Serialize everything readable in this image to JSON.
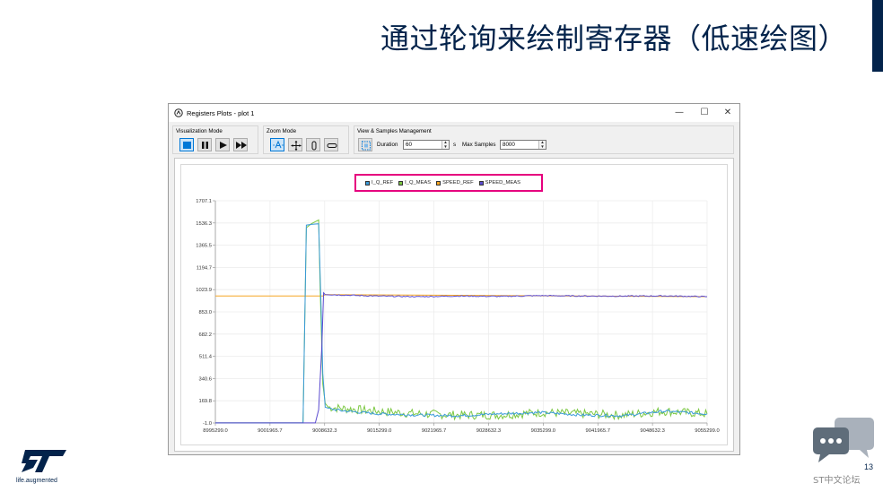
{
  "slide": {
    "title": "通过轮询来绘制寄存器（低速绘图）",
    "page_number": "13",
    "brand_tagline": "life.augmented",
    "forum_label": "ST中文论坛",
    "colors": {
      "navy": "#03234b",
      "highlight": "#e6007e"
    }
  },
  "window": {
    "title": "Registers Plots - plot 1",
    "controls": {
      "minimize": "—",
      "maximize": "☐",
      "close": "✕"
    }
  },
  "toolbar": {
    "visualization": {
      "label": "Visualization Mode",
      "buttons": [
        "stop-icon",
        "pause-icon",
        "play-icon",
        "fast-forward-icon"
      ]
    },
    "zoom": {
      "label": "Zoom Mode",
      "buttons": [
        "zoom-auto-icon",
        "zoom-xy-icon",
        "zoom-vertical-icon",
        "zoom-horizontal-icon"
      ]
    },
    "samples": {
      "label": "View & Samples Management",
      "duration_label": "Duration",
      "duration_value": "60",
      "duration_unit": "s",
      "max_samples_label": "Max Samples",
      "max_samples_value": "8000"
    }
  },
  "chart_data": {
    "type": "line",
    "title": "",
    "xlabel": "",
    "ylabel": "",
    "xlim": [
      8995299.0,
      9055299.0
    ],
    "ylim": [
      -1.0,
      1707.1
    ],
    "x_ticks": [
      "8995299.0",
      "9001965.7",
      "9008632.3",
      "9015299.0",
      "9021965.7",
      "9028632.3",
      "9035299.0",
      "9041965.7",
      "9048632.3",
      "9055299.0"
    ],
    "y_ticks": [
      "1707.1",
      "1536.3",
      "1365.5",
      "1194.7",
      "1023.9",
      "853.0",
      "682.2",
      "511.4",
      "340.6",
      "169.8",
      "-1.0"
    ],
    "grid": true,
    "legend_position": "top-center",
    "series": [
      {
        "name": "I_Q_REF",
        "color": "#3a9ad9",
        "x": [
          8995299,
          9006000,
          9006400,
          9007000,
          9007900,
          9008200,
          9008400,
          9008700,
          9009100,
          9010500,
          9015000,
          9020000,
          9025000,
          9030000,
          9035000,
          9040000,
          9045000,
          9050000,
          9055299
        ],
        "values": [
          0,
          0,
          1520,
          1525,
          1530,
          900,
          380,
          120,
          110,
          95,
          70,
          60,
          55,
          70,
          80,
          60,
          55,
          90,
          70
        ]
      },
      {
        "name": "I_Q_MEAS",
        "color": "#7bc842",
        "x": [
          8995299,
          9006000,
          9006400,
          9007000,
          9007900,
          9008100,
          9008400,
          9008700,
          9009100,
          9015000,
          9020000,
          9025000,
          9030000,
          9035000,
          9040000,
          9045000,
          9050000,
          9055299
        ],
        "values": [
          0,
          0,
          1500,
          1530,
          1560,
          1000,
          300,
          150,
          120,
          90,
          70,
          60,
          60,
          80,
          70,
          60,
          90,
          70
        ]
      },
      {
        "name": "SPEED_REF",
        "color": "#f5a623",
        "x": [
          8995299,
          9008400,
          9008700,
          9055299
        ],
        "values": [
          975,
          975,
          985,
          970
        ]
      },
      {
        "name": "SPEED_MEAS",
        "color": "#5b4bd0",
        "x": [
          8995299,
          9007500,
          9007900,
          9008300,
          9008500,
          9008700,
          9009500,
          9015000,
          9020000,
          9025000,
          9030000,
          9035000,
          9040000,
          9045000,
          9050000,
          9055299
        ],
        "values": [
          0,
          0,
          100,
          600,
          1000,
          985,
          985,
          975,
          970,
          975,
          972,
          978,
          975,
          974,
          976,
          970
        ]
      }
    ]
  }
}
